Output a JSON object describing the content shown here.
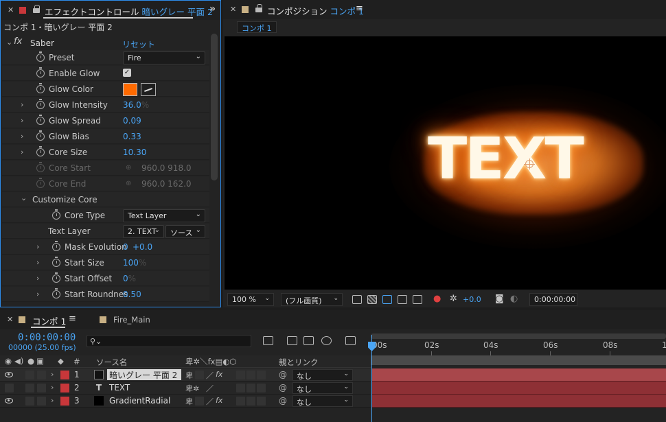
{
  "effect_controls": {
    "tab_prefix": "エフェクトコントロール",
    "tab_layer": "暗いグレー 平面 2",
    "subtitle": "コンポ 1・暗いグレー 平面 2",
    "effect_name": "Saber",
    "reset_label": "リセット",
    "rows": {
      "preset": {
        "label": "Preset",
        "value": "Fire"
      },
      "enable_glow": {
        "label": "Enable Glow",
        "checked": true
      },
      "glow_color": {
        "label": "Glow Color",
        "color": "#ff6a00"
      },
      "glow_intensity": {
        "label": "Glow Intensity",
        "value": "36.0",
        "unit": "%"
      },
      "glow_spread": {
        "label": "Glow Spread",
        "value": "0.09"
      },
      "glow_bias": {
        "label": "Glow Bias",
        "value": "0.33"
      },
      "core_size": {
        "label": "Core Size",
        "value": "10.30"
      },
      "core_start": {
        "label": "Core Start",
        "value": "960.0 918.0"
      },
      "core_end": {
        "label": "Core End",
        "value": "960.0 162.0"
      },
      "customize_core": {
        "label": "Customize Core"
      },
      "core_type": {
        "label": "Core Type",
        "value": "Text Layer"
      },
      "text_layer": {
        "label": "Text Layer",
        "value": "2. TEXT",
        "source": "ソース"
      },
      "mask_evolution": {
        "label": "Mask Evolution",
        "value_a": "0",
        "value_b": "+0.0"
      },
      "start_size": {
        "label": "Start Size",
        "value": "100",
        "unit": "%"
      },
      "start_offset": {
        "label": "Start Offset",
        "value": "0",
        "unit": "%"
      },
      "start_roundness": {
        "label": "Start Roundnes",
        "value": "0.50"
      }
    }
  },
  "composition": {
    "tab_prefix": "コンポジション",
    "tab_name": "コンポ 1",
    "subtab": "コンポ 1",
    "viewer_text": "TEXT",
    "zoom": "100 %",
    "resolution": "(フル画質)",
    "exposure": "+0.0",
    "timecode": "0:00:00:00"
  },
  "timeline": {
    "tab_comp": "コンポ 1",
    "tab_other": "Fire_Main",
    "timecode": "0:00:00:00",
    "frames": "00000 (25.00 fps)",
    "headers": {
      "num": "#",
      "source_name": "ソース名",
      "parent": "親とリンク"
    },
    "ruler": [
      "00s",
      "02s",
      "04s",
      "06s",
      "08s",
      "1"
    ],
    "layers": [
      {
        "num": "1",
        "name": "暗いグレー 平面 2",
        "parent": "なし",
        "selected": true
      },
      {
        "num": "2",
        "name": "TEXT",
        "parent": "なし",
        "selected": false
      },
      {
        "num": "3",
        "name": "GradientRadial",
        "parent": "なし",
        "selected": false
      }
    ]
  },
  "colors": {
    "accent": "#4aa5f5",
    "layer_label": "#c8373a",
    "layer_bar": "#8e3035",
    "glow": "#ff6a00"
  }
}
